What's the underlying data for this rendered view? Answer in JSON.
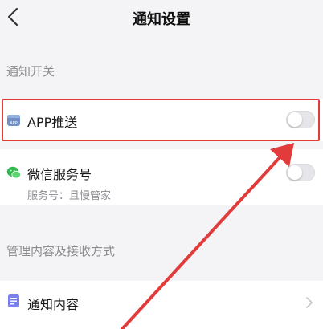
{
  "header": {
    "title": "通知设置"
  },
  "sections": {
    "notify_switch": "通知开关",
    "manage": "管理内容及接收方式"
  },
  "rows": {
    "app_push": {
      "label": "APP推送",
      "icon_text": "APP",
      "enabled": false
    },
    "wechat": {
      "label": "微信服务号",
      "sub": "服务号：且慢管家",
      "enabled": false
    },
    "content": {
      "label": "通知内容"
    }
  },
  "colors": {
    "accent_wechat": "#2fb84a",
    "app_icon": "#6f8fc6",
    "content_icon": "#7a7ff0",
    "annotation": "#e23b3b"
  }
}
